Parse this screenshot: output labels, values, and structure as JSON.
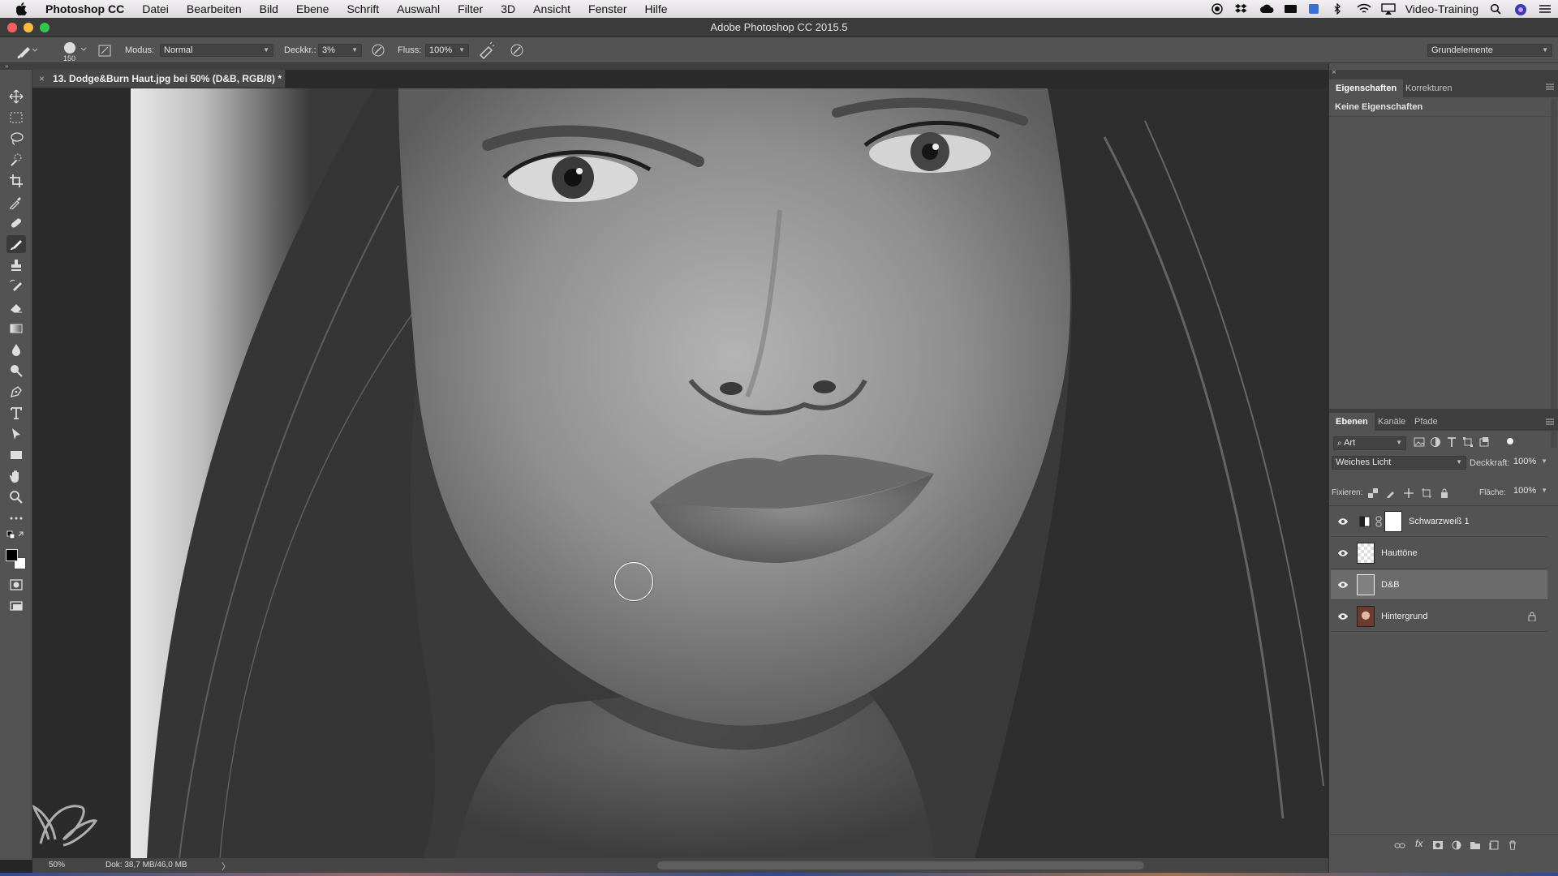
{
  "menubar": {
    "apple": "",
    "app_name": "Photoshop CC",
    "items": [
      "Datei",
      "Bearbeiten",
      "Bild",
      "Ebene",
      "Schrift",
      "Auswahl",
      "Filter",
      "3D",
      "Ansicht",
      "Fenster",
      "Hilfe"
    ],
    "user": "Video-Training"
  },
  "window": {
    "title": "Adobe Photoshop CC 2015.5"
  },
  "options": {
    "brush_size": "150",
    "mode_label": "Modus:",
    "mode_value": "Normal",
    "opacity_label": "Deckkr.:",
    "opacity_value": "3%",
    "flow_label": "Fluss:",
    "flow_value": "100%",
    "workspace": "Grundelemente"
  },
  "document": {
    "tab_title": "13. Dodge&Burn Haut.jpg bei 50% (D&B, RGB/8) *",
    "zoom": "50%",
    "doc_info": "Dok: 38,7 MB/46,0 MB",
    "arrow": "〉"
  },
  "properties": {
    "tabs": [
      "Eigenschaften",
      "Korrekturen"
    ],
    "empty_text": "Keine Eigenschaften"
  },
  "layers_panel": {
    "tabs": [
      "Ebenen",
      "Kanäle",
      "Pfade"
    ],
    "filter_value": "Art",
    "blend_mode": "Weiches Licht",
    "opacity_label": "Deckkraft:",
    "opacity_value": "100%",
    "lock_label": "Fixieren:",
    "fill_label": "Fläche:",
    "fill_value": "100%",
    "layers": [
      {
        "name": "Schwarzweiß 1",
        "visible": true,
        "selected": false,
        "type": "adjustment"
      },
      {
        "name": "Hauttöne",
        "visible": true,
        "selected": false,
        "type": "transparent"
      },
      {
        "name": "D&B",
        "visible": true,
        "selected": true,
        "type": "gray"
      },
      {
        "name": "Hintergrund",
        "visible": true,
        "selected": false,
        "type": "photo",
        "locked": true
      }
    ]
  },
  "colors": {
    "ui_dark": "#535353",
    "selected_layer": "#6b6b6b",
    "foreground": "#000000",
    "background": "#ffffff"
  }
}
